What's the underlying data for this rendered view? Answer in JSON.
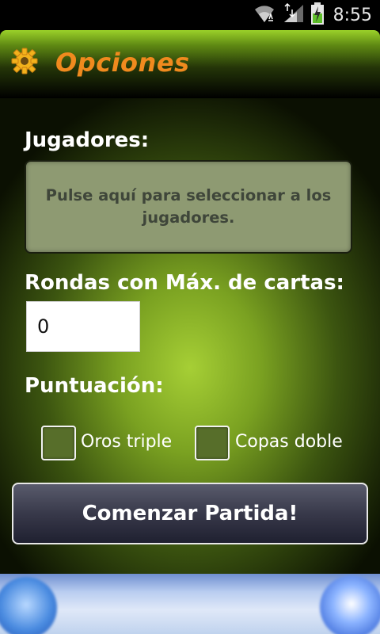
{
  "status_bar": {
    "time": "8:55",
    "icons": [
      "wifi-icon",
      "signal-icon",
      "battery-charging-icon"
    ]
  },
  "action_bar": {
    "title": "Opciones",
    "icon": "gear-icon",
    "colors": {
      "title": "#f08a1e",
      "bar_top": "#9bd12a"
    }
  },
  "form": {
    "players_label": "Jugadores:",
    "players_box_text": "Pulse aquí para seleccionar a los jugadores.",
    "rounds_label": "Rondas con Máx. de cartas:",
    "rounds_value": "0",
    "scoring_label": "Puntuación:",
    "checkboxes": [
      {
        "label": "Oros triple",
        "checked": false
      },
      {
        "label": "Copas doble",
        "checked": false
      }
    ],
    "start_button": "Comenzar Partida!"
  },
  "ad_banner": {
    "text": "",
    "subtext": ""
  }
}
